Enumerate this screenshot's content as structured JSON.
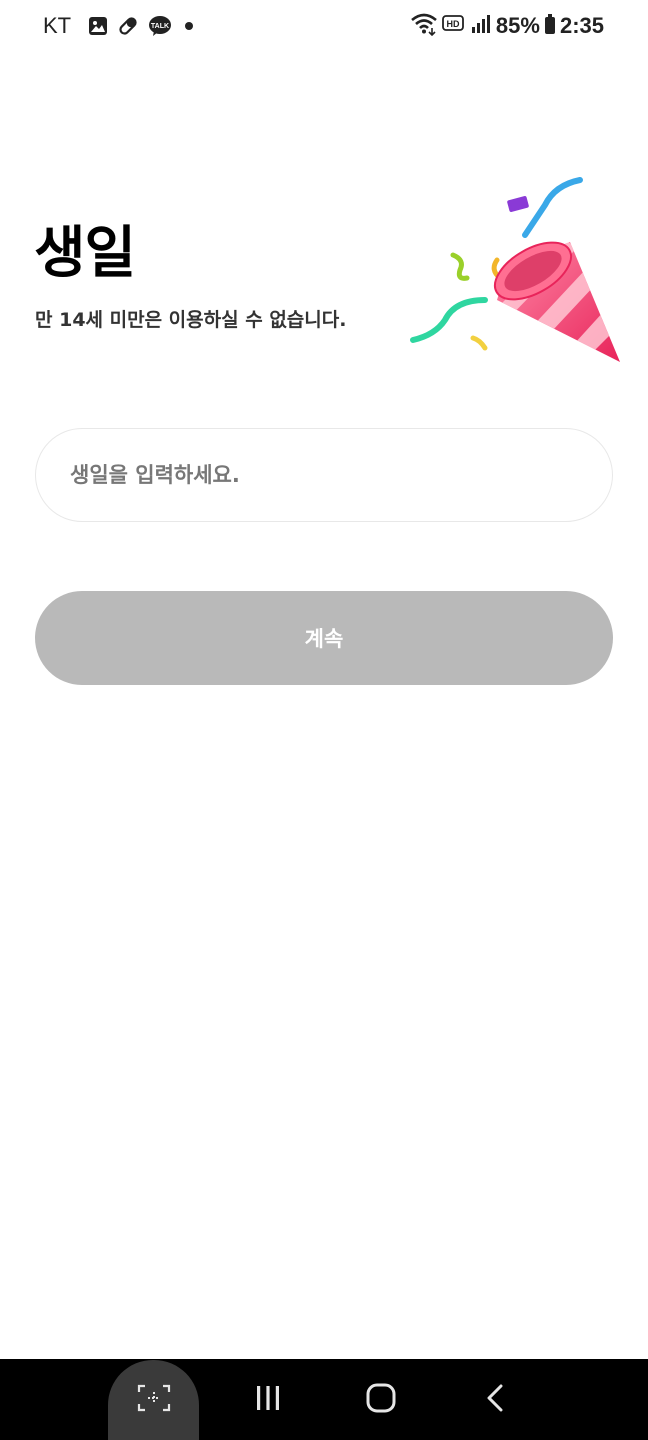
{
  "status_bar": {
    "carrier": "KT",
    "battery": "85%",
    "time": "2:35",
    "kakao_badge": "TALK",
    "notification_icons": [
      "gallery-icon",
      "pill-icon",
      "kakaotalk-icon",
      "dot-icon"
    ],
    "system_icons": [
      "wifi-icon",
      "hd-icon",
      "signal-icon",
      "battery-icon"
    ]
  },
  "header": {
    "title": "생일",
    "subtitle": "만 14세 미만은 이용하실 수 없습니다."
  },
  "birthday_field": {
    "value": "",
    "placeholder": "생일을 입력하세요."
  },
  "continue_button": {
    "label": "계속",
    "enabled": false,
    "color": "#b9b9b9"
  },
  "nav_bar": {
    "buttons": [
      "capture-icon",
      "recents-icon",
      "home-icon",
      "back-icon"
    ]
  },
  "colors": {
    "accent_pink": "#f0486e",
    "background": "#ffffff",
    "disabled": "#b9b9b9"
  }
}
